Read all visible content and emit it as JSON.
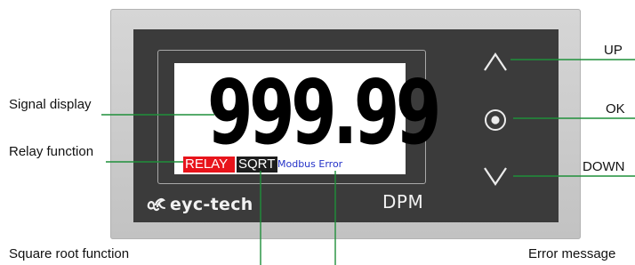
{
  "display": {
    "reading": "999.99",
    "relay_tag": "RELAY",
    "sqrt_tag": "SQRT",
    "error_tag": "Modbus Error"
  },
  "device": {
    "brand": "eyc-tech",
    "model": "DPM"
  },
  "callouts": {
    "signal_display": "Signal display",
    "relay_function": "Relay function",
    "square_root_function": "Square root function",
    "error_message": "Error message",
    "up": "UP",
    "ok": "OK",
    "down": "DOWN"
  },
  "colors": {
    "relay_bg": "#e8141b",
    "sqrt_bg": "#1d1d1d",
    "error_text": "#2432c8",
    "callout_line": "#1f8f3a",
    "face": "#3b3b3b",
    "bezel": "#cbcbcb"
  },
  "icons": {
    "up_key": "chevron-up-icon",
    "ok_key": "circle-dot-icon",
    "down_key": "chevron-down-icon",
    "logo": "eyc-logo-icon"
  }
}
